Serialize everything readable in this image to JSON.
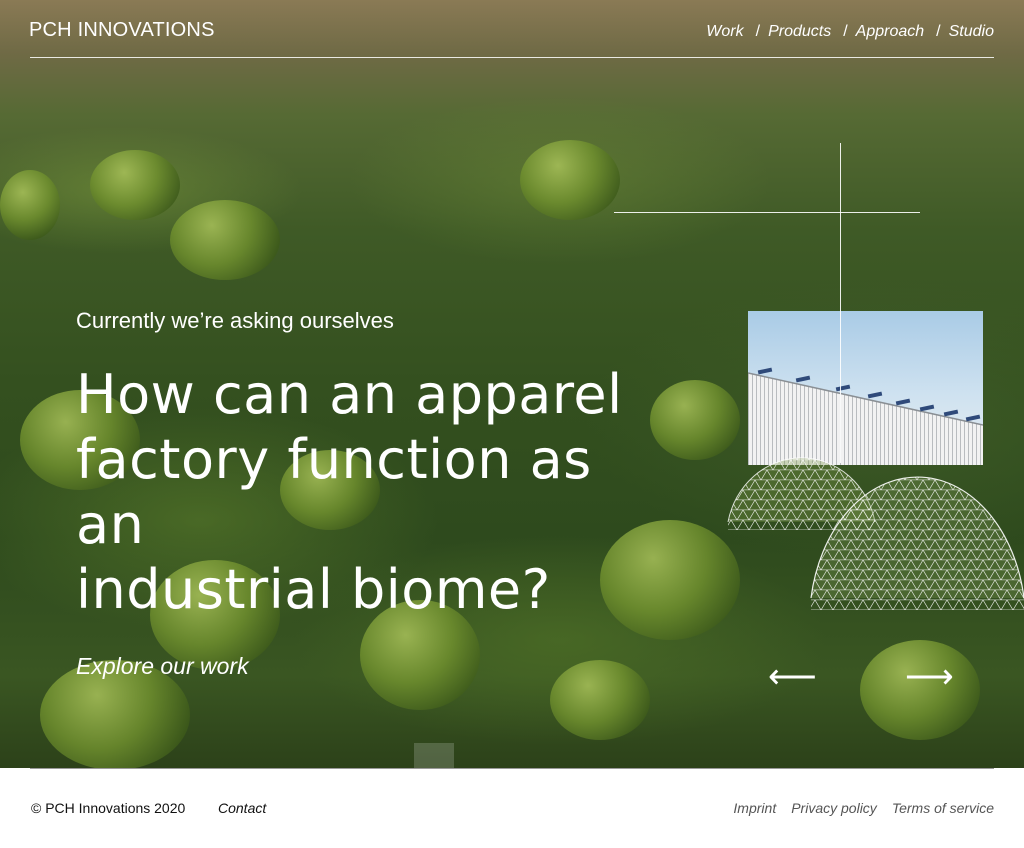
{
  "header": {
    "logo": "PCH INNOVATIONS",
    "nav": [
      {
        "label": "Work"
      },
      {
        "label": "Products"
      },
      {
        "label": "Approach"
      },
      {
        "label": "Studio"
      }
    ],
    "separator": "/"
  },
  "hero": {
    "eyebrow": "Currently we’re asking ourselves",
    "headline_lines": [
      "How can an apparel",
      "factory function as an",
      "industrial biome?"
    ],
    "cta": "Explore our work",
    "prev_arrow": "⟵",
    "next_arrow": "⟶"
  },
  "footer": {
    "copyright": "© PCH Innovations 2020",
    "contact": "Contact",
    "links": [
      {
        "label": "Imprint"
      },
      {
        "label": "Privacy policy"
      },
      {
        "label": "Terms of service"
      }
    ]
  },
  "colors": {
    "text_on_hero": "#ffffff",
    "footer_text": "#111111",
    "footer_links": "#555555"
  }
}
